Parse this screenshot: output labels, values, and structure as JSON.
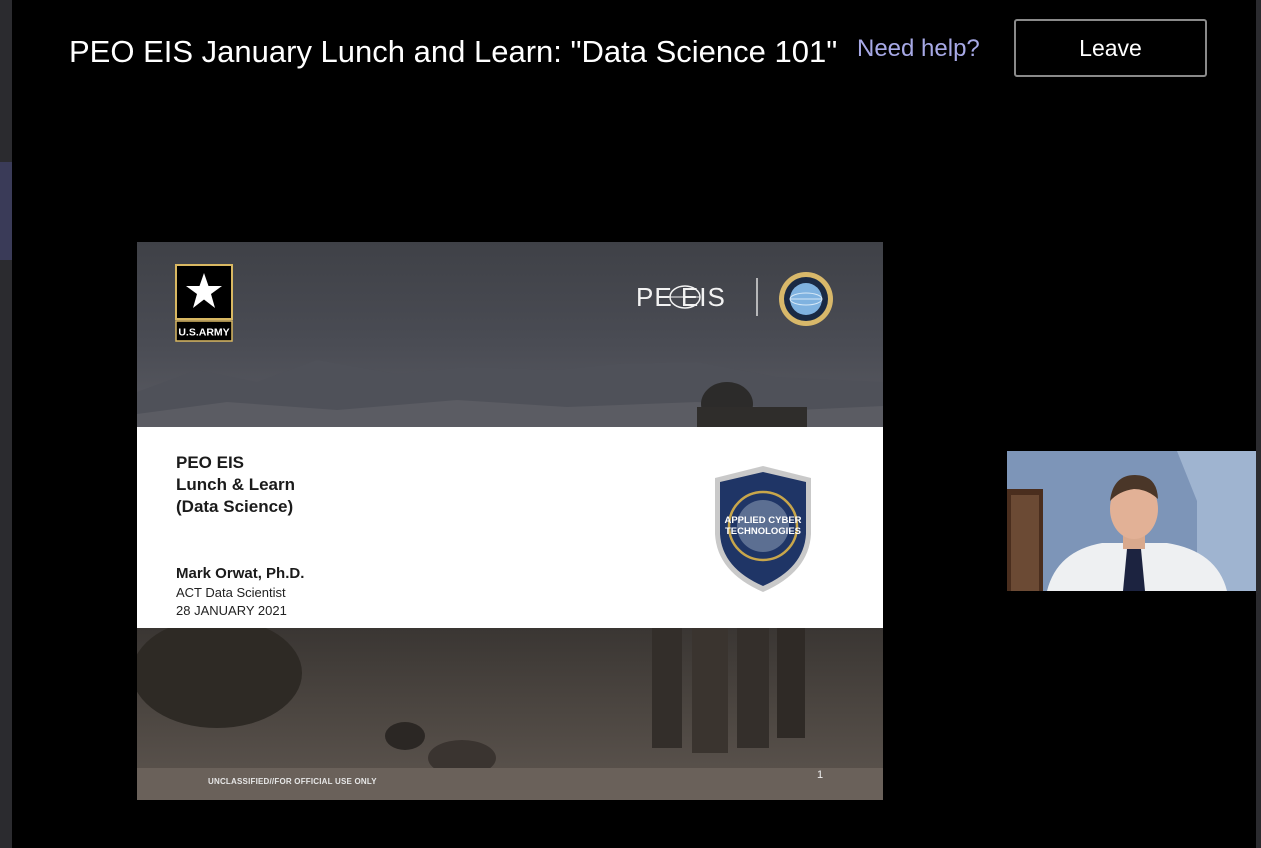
{
  "meeting": {
    "title": "PEO EIS January Lunch and Learn: \"Data Science 101\"",
    "help_link": "Need help?",
    "leave_label": "Leave"
  },
  "slide": {
    "army_logo_text": "U.S.ARMY",
    "peo_logo_text": "PE EIS",
    "badge_text_1": "APPLIED CYBER",
    "badge_text_2": "TECHNOLOGIES",
    "heading_lines": [
      "PEO EIS",
      "Lunch & Learn",
      "(Data Science)"
    ],
    "presenter_name": "Mark Orwat, Ph.D.",
    "presenter_role": "ACT Data Scientist",
    "presenter_date": "28 JANUARY 2021",
    "footer": "UNCLASSIFIED//FOR OFFICIAL USE ONLY",
    "page_number": "1"
  },
  "colors": {
    "background": "#000000",
    "help_link": "#a7a9e6",
    "leave_border": "#8a8a8a",
    "badge_navy": "#1f3566",
    "badge_gold": "#c8a64b"
  },
  "icons": [
    "army-star-logo",
    "peo-eis-logo",
    "globe-seal-logo",
    "act-shield-badge"
  ]
}
